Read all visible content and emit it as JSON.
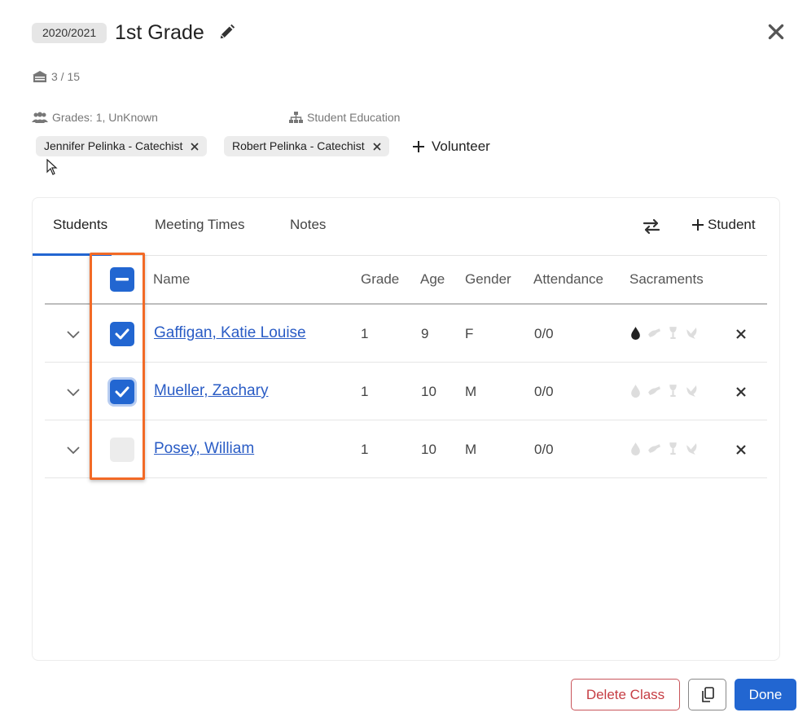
{
  "header": {
    "year": "2020/2021",
    "title": "1st Grade",
    "capacity": "3 / 15",
    "grades": "Grades: 1, UnKnown",
    "program": "Student Education"
  },
  "volunteers": {
    "chips": [
      {
        "label": "Jennifer Pelinka - Catechist"
      },
      {
        "label": "Robert Pelinka - Catechist"
      }
    ],
    "add_label": "Volunteer"
  },
  "tabs": [
    {
      "label": "Students",
      "active": true
    },
    {
      "label": "Meeting Times",
      "active": false
    },
    {
      "label": "Notes",
      "active": false
    }
  ],
  "add_student_label": "Student",
  "table": {
    "columns": [
      "Name",
      "Grade",
      "Age",
      "Gender",
      "Attendance",
      "Sacraments"
    ],
    "rows": [
      {
        "name": "Gaffigan, Katie Louise",
        "grade": "1",
        "age": "9",
        "gender": "F",
        "attendance": "0/0",
        "checked": true,
        "baptism_received": true
      },
      {
        "name": "Mueller, Zachary",
        "grade": "1",
        "age": "10",
        "gender": "M",
        "attendance": "0/0",
        "checked": true,
        "baptism_received": false
      },
      {
        "name": "Posey, William",
        "grade": "1",
        "age": "10",
        "gender": "M",
        "attendance": "0/0",
        "checked": false,
        "baptism_received": false
      }
    ]
  },
  "footer": {
    "delete_label": "Delete Class",
    "done_label": "Done"
  },
  "icons": [
    "classroom-icon",
    "users-icon",
    "sitemap-icon",
    "pencil-icon",
    "close-icon",
    "swap-icon",
    "plus-icon",
    "chevron-down-icon",
    "drop-icon",
    "hands-icon",
    "chalice-icon",
    "dove-icon",
    "copy-icon"
  ],
  "colors": {
    "accent": "#2266d1",
    "link": "#2a5cc5",
    "danger": "#c63d43",
    "highlight": "#f26a26",
    "sacrament_received": "#222222",
    "sacrament_pending": "#dddddd"
  }
}
